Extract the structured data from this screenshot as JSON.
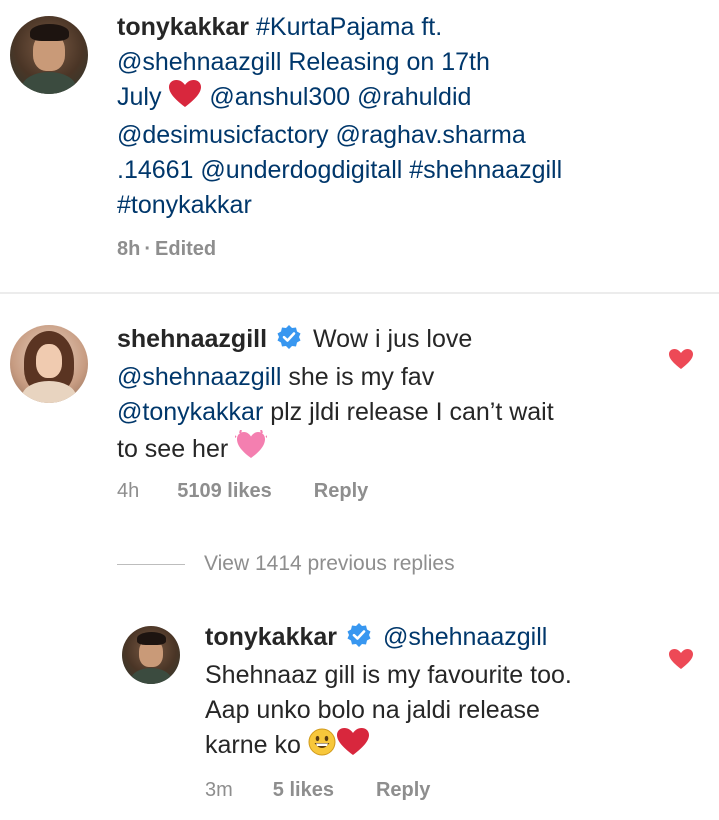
{
  "caption": {
    "username": "tonykakkar",
    "line1_rest": "#KurtaPajama ft.",
    "line2": "@shehnaazgill Releasing on 17th",
    "line3_start": "July",
    "line3_tags": "@anshul300 @rahuldid",
    "line4": "@desimusicfactory @raghav.sharma",
    "line5": ".14661 @underdogdigitall #shehnaazgill",
    "line6": "#tonykakkar",
    "time": "8h",
    "separator": "·",
    "edited": "Edited"
  },
  "comment": {
    "username": "shehnaazgill",
    "line1_text": "Wow i jus love",
    "line2_tag": "@shehnaazgill",
    "line2_text": " she is my fav",
    "line3_tag": "@tonykakkar",
    "line3_text": " plz jldi release I can’t wait",
    "line4_text": "to see her",
    "time": "4h",
    "likes": "5109 likes",
    "reply": "Reply",
    "liked": true
  },
  "view_replies": "View 1414 previous replies",
  "reply": {
    "username": "tonykakkar",
    "mention": "@shehnaazgill",
    "line2": "Shehnaaz gill is my favourite too.",
    "line3": "Aap unko bolo na jaldi release",
    "line4": "karne ko",
    "time": "3m",
    "likes": "5 likes",
    "reply_label": "Reply",
    "liked": true
  },
  "colors": {
    "text": "#262626",
    "link": "#00376b",
    "muted": "#8e8e8e",
    "heart": "#ed4956",
    "verified": "#3897f0"
  },
  "icons": [
    "heart-icon",
    "verified-badge-icon",
    "sparkling-heart-icon",
    "grinning-face-icon"
  ]
}
